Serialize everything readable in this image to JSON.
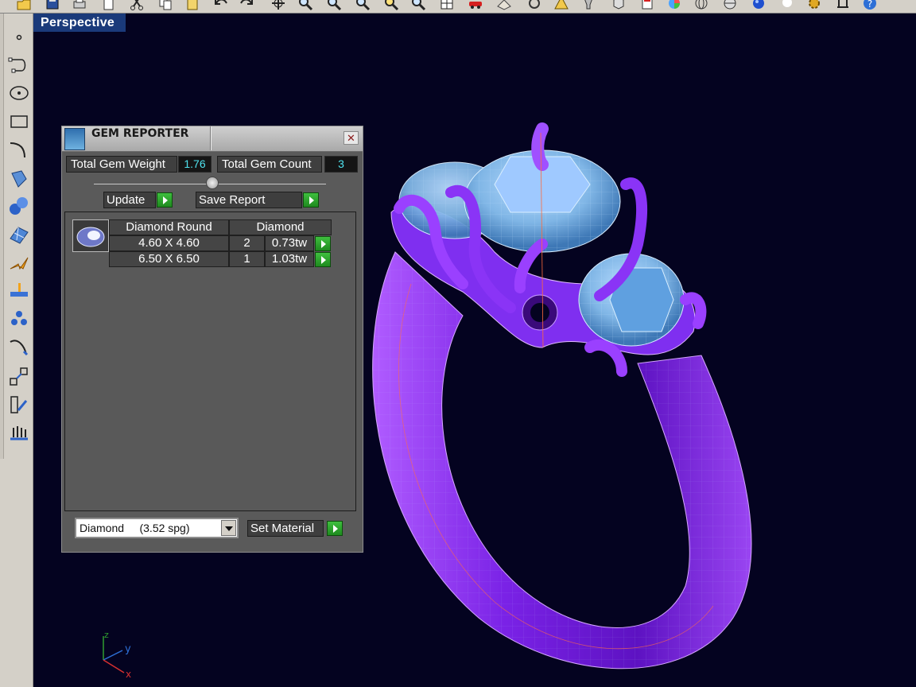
{
  "viewport": {
    "label": "Perspective"
  },
  "gem_reporter": {
    "title": "GEM REPORTER",
    "close_label": "✕",
    "total_weight_label": "Total Gem Weight",
    "total_weight_value": "1.76",
    "total_count_label": "Total Gem Count",
    "total_count_value": "3",
    "update_label": "Update",
    "save_report_label": "Save Report",
    "set_material_label": "Set Material",
    "material_value": "Diamond     (3.52 spg)",
    "gem_group": {
      "name": "Diamond Round",
      "type": "Diamond",
      "rows": [
        {
          "size": "4.60 X 4.60",
          "count": "2",
          "weight": "0.73tw"
        },
        {
          "size": "6.50 X 6.50",
          "count": "1",
          "weight": "1.03tw"
        }
      ]
    }
  },
  "axis": {
    "x": "x",
    "y": "y",
    "z": "z"
  },
  "colors": {
    "viewport_bg": "#040320",
    "ring_metal": "#7a22e6",
    "gem": "#8ec8f2",
    "value_text": "#4fe3ef",
    "action_green": "#2fa52f"
  }
}
